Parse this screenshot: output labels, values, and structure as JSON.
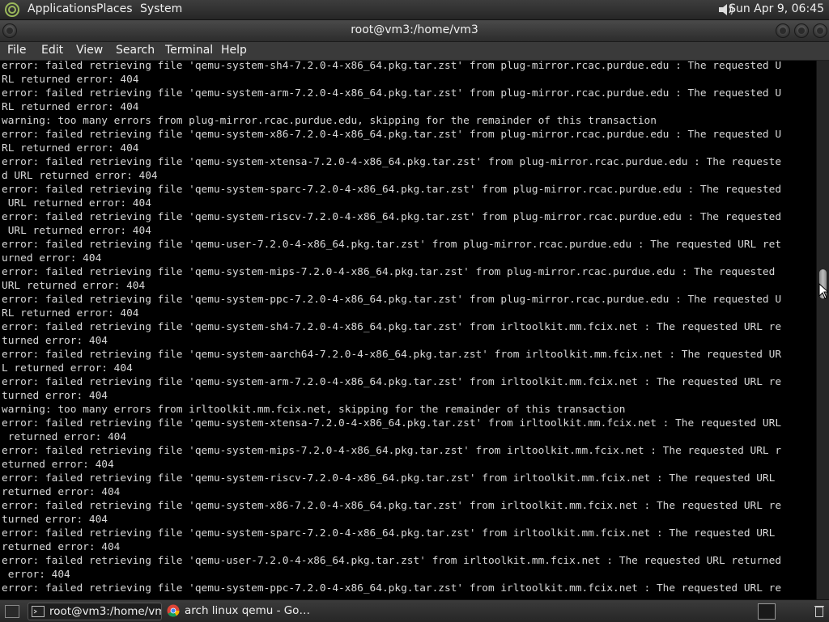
{
  "top_panel": {
    "menus": [
      "Applications",
      "Places",
      "System"
    ],
    "clock": "Sun Apr  9, 06:45",
    "icons": [
      "distro-logo-icon",
      "volume-icon"
    ]
  },
  "window": {
    "title": "root@vm3:/home/vm3",
    "menubar": [
      "File",
      "Edit",
      "View",
      "Search",
      "Terminal",
      "Help"
    ]
  },
  "terminal": {
    "lines": [
      "error: failed retrieving file 'qemu-system-sh4-7.2.0-4-x86_64.pkg.tar.zst' from plug-mirror.rcac.purdue.edu : The requested U",
      "RL returned error: 404",
      "error: failed retrieving file 'qemu-system-arm-7.2.0-4-x86_64.pkg.tar.zst' from plug-mirror.rcac.purdue.edu : The requested U",
      "RL returned error: 404",
      "warning: too many errors from plug-mirror.rcac.purdue.edu, skipping for the remainder of this transaction",
      "error: failed retrieving file 'qemu-system-x86-7.2.0-4-x86_64.pkg.tar.zst' from plug-mirror.rcac.purdue.edu : The requested U",
      "RL returned error: 404",
      "error: failed retrieving file 'qemu-system-xtensa-7.2.0-4-x86_64.pkg.tar.zst' from plug-mirror.rcac.purdue.edu : The requeste",
      "d URL returned error: 404",
      "error: failed retrieving file 'qemu-system-sparc-7.2.0-4-x86_64.pkg.tar.zst' from plug-mirror.rcac.purdue.edu : The requested",
      " URL returned error: 404",
      "error: failed retrieving file 'qemu-system-riscv-7.2.0-4-x86_64.pkg.tar.zst' from plug-mirror.rcac.purdue.edu : The requested",
      " URL returned error: 404",
      "error: failed retrieving file 'qemu-user-7.2.0-4-x86_64.pkg.tar.zst' from plug-mirror.rcac.purdue.edu : The requested URL ret",
      "urned error: 404",
      "error: failed retrieving file 'qemu-system-mips-7.2.0-4-x86_64.pkg.tar.zst' from plug-mirror.rcac.purdue.edu : The requested",
      "URL returned error: 404",
      "error: failed retrieving file 'qemu-system-ppc-7.2.0-4-x86_64.pkg.tar.zst' from plug-mirror.rcac.purdue.edu : The requested U",
      "RL returned error: 404",
      "error: failed retrieving file 'qemu-system-sh4-7.2.0-4-x86_64.pkg.tar.zst' from irltoolkit.mm.fcix.net : The requested URL re",
      "turned error: 404",
      "error: failed retrieving file 'qemu-system-aarch64-7.2.0-4-x86_64.pkg.tar.zst' from irltoolkit.mm.fcix.net : The requested UR",
      "L returned error: 404",
      "error: failed retrieving file 'qemu-system-arm-7.2.0-4-x86_64.pkg.tar.zst' from irltoolkit.mm.fcix.net : The requested URL re",
      "turned error: 404",
      "warning: too many errors from irltoolkit.mm.fcix.net, skipping for the remainder of this transaction",
      "error: failed retrieving file 'qemu-system-xtensa-7.2.0-4-x86_64.pkg.tar.zst' from irltoolkit.mm.fcix.net : The requested URL",
      " returned error: 404",
      "error: failed retrieving file 'qemu-system-mips-7.2.0-4-x86_64.pkg.tar.zst' from irltoolkit.mm.fcix.net : The requested URL r",
      "eturned error: 404",
      "error: failed retrieving file 'qemu-system-riscv-7.2.0-4-x86_64.pkg.tar.zst' from irltoolkit.mm.fcix.net : The requested URL",
      "returned error: 404",
      "error: failed retrieving file 'qemu-system-x86-7.2.0-4-x86_64.pkg.tar.zst' from irltoolkit.mm.fcix.net : The requested URL re",
      "turned error: 404",
      "error: failed retrieving file 'qemu-system-sparc-7.2.0-4-x86_64.pkg.tar.zst' from irltoolkit.mm.fcix.net : The requested URL",
      "returned error: 404",
      "error: failed retrieving file 'qemu-user-7.2.0-4-x86_64.pkg.tar.zst' from irltoolkit.mm.fcix.net : The requested URL returned",
      " error: 404",
      "error: failed retrieving file 'qemu-system-ppc-7.2.0-4-x86_64.pkg.tar.zst' from irltoolkit.mm.fcix.net : The requested URL re"
    ]
  },
  "taskbar": {
    "tasks": [
      {
        "label": "root@vm3:/home/vm3",
        "icon": "terminal-icon",
        "active": true
      },
      {
        "label": "arch linux qemu - Go…",
        "icon": "chrome-icon",
        "active": false
      }
    ]
  }
}
